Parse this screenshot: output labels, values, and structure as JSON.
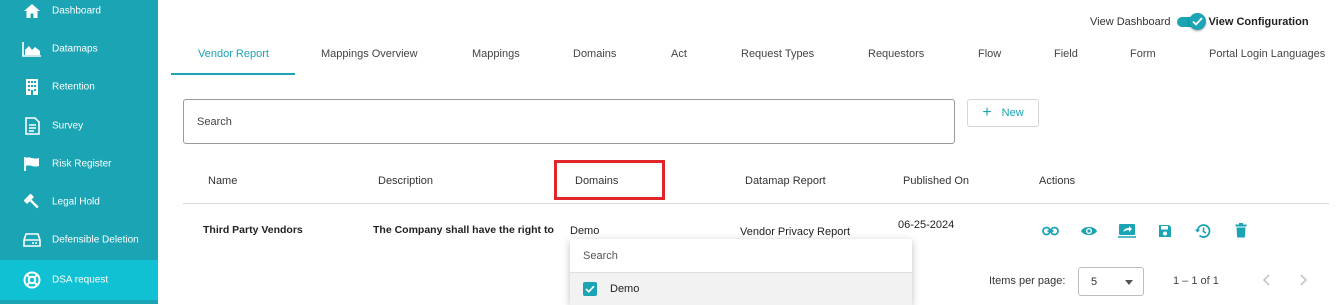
{
  "sidebar": {
    "items": [
      {
        "label": "Dashboard",
        "icon": "home-icon"
      },
      {
        "label": "Datamaps",
        "icon": "area-chart-icon"
      },
      {
        "label": "Retention",
        "icon": "building-icon"
      },
      {
        "label": "Survey",
        "icon": "document-icon"
      },
      {
        "label": "Risk Register",
        "icon": "flag-icon"
      },
      {
        "label": "Legal Hold",
        "icon": "gavel-icon"
      },
      {
        "label": "Defensible Deletion",
        "icon": "drive-icon"
      },
      {
        "label": "DSA request",
        "icon": "lifebuoy-icon"
      }
    ],
    "active": "DSA request",
    "colors": {
      "background": "#1ba4b4",
      "active": "#0fc1d3"
    }
  },
  "header": {
    "view_dashboard_label": "View Dashboard",
    "view_configuration_label": "View Configuration",
    "toggle_on": true
  },
  "tabs": [
    {
      "label": "Vendor Report",
      "active": true
    },
    {
      "label": "Mappings Overview"
    },
    {
      "label": "Mappings"
    },
    {
      "label": "Domains"
    },
    {
      "label": "Act"
    },
    {
      "label": "Request Types"
    },
    {
      "label": "Requestors"
    },
    {
      "label": "Flow"
    },
    {
      "label": "Field"
    },
    {
      "label": "Form"
    },
    {
      "label": "Portal Login Languages"
    }
  ],
  "search": {
    "placeholder": "Search",
    "value": ""
  },
  "new_button": {
    "label": "New"
  },
  "table": {
    "columns": [
      "Name",
      "Description",
      "Domains",
      "Datamap Report",
      "Published On",
      "Actions"
    ],
    "rows": [
      {
        "name": "Third Party Vendors",
        "description": "The Company shall have the right to",
        "domains": "Demo",
        "datamap_report": "Vendor Privacy Report",
        "published_on": "06-25-2024",
        "actions": [
          "link-icon",
          "eye-icon",
          "share-icon",
          "save-icon",
          "history-icon",
          "delete-icon"
        ]
      }
    ]
  },
  "domains_dropdown": {
    "search_placeholder": "Search",
    "options": [
      {
        "label": "Demo",
        "checked": true
      }
    ]
  },
  "pagination": {
    "items_per_page_label": "Items per page:",
    "items_per_page": "5",
    "range": "1 – 1 of 1"
  },
  "accent_color": "#1ba4b4",
  "highlight_color": "#e0262b"
}
